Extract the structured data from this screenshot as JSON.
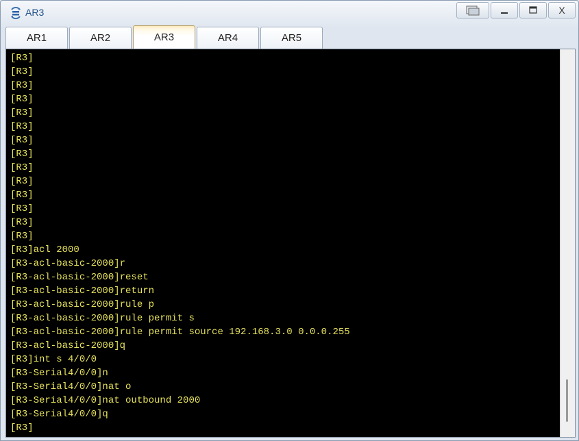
{
  "window": {
    "title": "AR3",
    "controls": {
      "restore_icon": "restore-window-icon",
      "minimize_label": "—",
      "maximize_label": "☐",
      "close_label": "X"
    }
  },
  "tabs": [
    {
      "label": "AR1",
      "active": false
    },
    {
      "label": "AR2",
      "active": false
    },
    {
      "label": "AR3",
      "active": true
    },
    {
      "label": "AR4",
      "active": false
    },
    {
      "label": "AR5",
      "active": false
    }
  ],
  "colors": {
    "terminal_bg": "#000000",
    "terminal_text": "#e6e25c",
    "title_text": "#1f4e86"
  },
  "terminal": {
    "lines": [
      "[R3]",
      "[R3]",
      "[R3]",
      "[R3]",
      "[R3]",
      "[R3]",
      "[R3]",
      "[R3]",
      "[R3]",
      "[R3]",
      "[R3]",
      "[R3]",
      "[R3]",
      "[R3]",
      "[R3]acl 2000",
      "[R3-acl-basic-2000]r",
      "[R3-acl-basic-2000]reset",
      "[R3-acl-basic-2000]return",
      "[R3-acl-basic-2000]rule p",
      "[R3-acl-basic-2000]rule permit s",
      "[R3-acl-basic-2000]rule permit source 192.168.3.0 0.0.0.255",
      "[R3-acl-basic-2000]q",
      "[R3]int s 4/0/0",
      "[R3-Serial4/0/0]n",
      "[R3-Serial4/0/0]nat o",
      "[R3-Serial4/0/0]nat outbound 2000",
      "[R3-Serial4/0/0]q",
      "[R3]"
    ]
  }
}
